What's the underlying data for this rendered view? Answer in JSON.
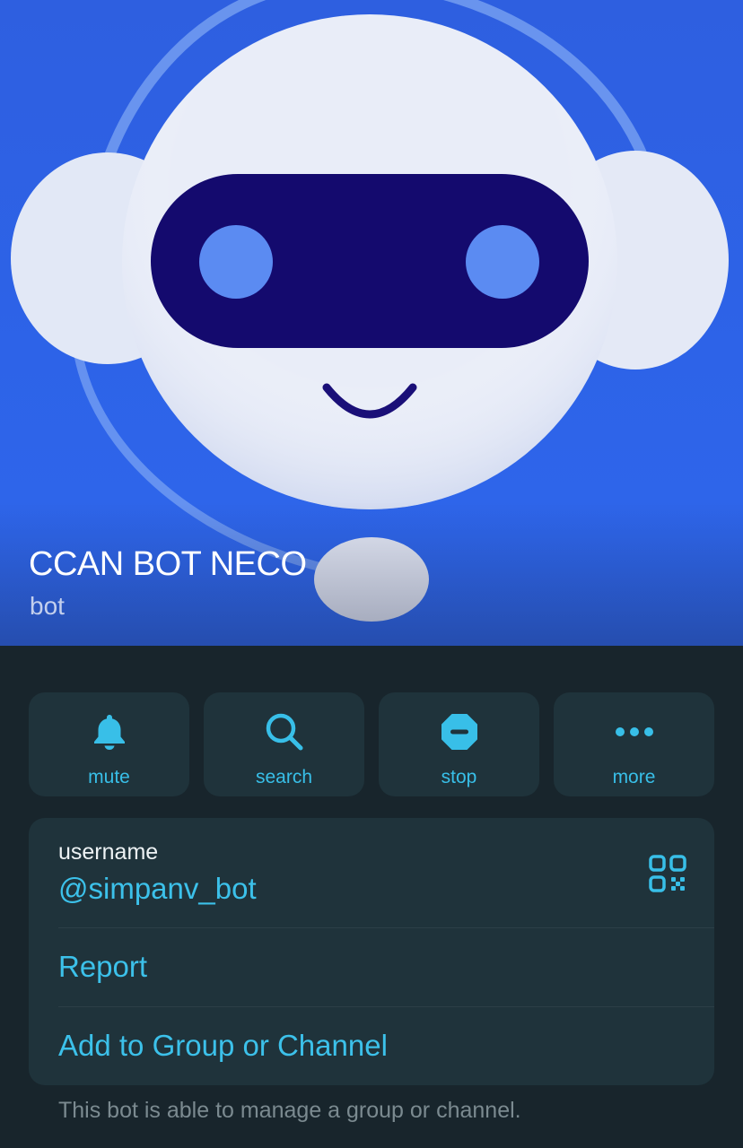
{
  "profile": {
    "name": "CCAN BOT NECO",
    "subtitle": "bot"
  },
  "actions": [
    {
      "label": "mute",
      "icon": "bell-icon"
    },
    {
      "label": "search",
      "icon": "search-icon"
    },
    {
      "label": "stop",
      "icon": "stop-icon"
    },
    {
      "label": "more",
      "icon": "more-dots-icon"
    }
  ],
  "info": {
    "username_label": "username",
    "username_value": "@simpanv_bot",
    "report_label": "Report",
    "add_label": "Add to Group or Channel",
    "qr_icon": "qr-code-icon"
  },
  "footnote": "This bot is able to manage a group or channel.",
  "colors": {
    "background": "#18252c",
    "card": "#1f333b",
    "accent": "#3cc1ea",
    "avatar_blue": "#2e63e8",
    "visor": "#140a6e"
  }
}
